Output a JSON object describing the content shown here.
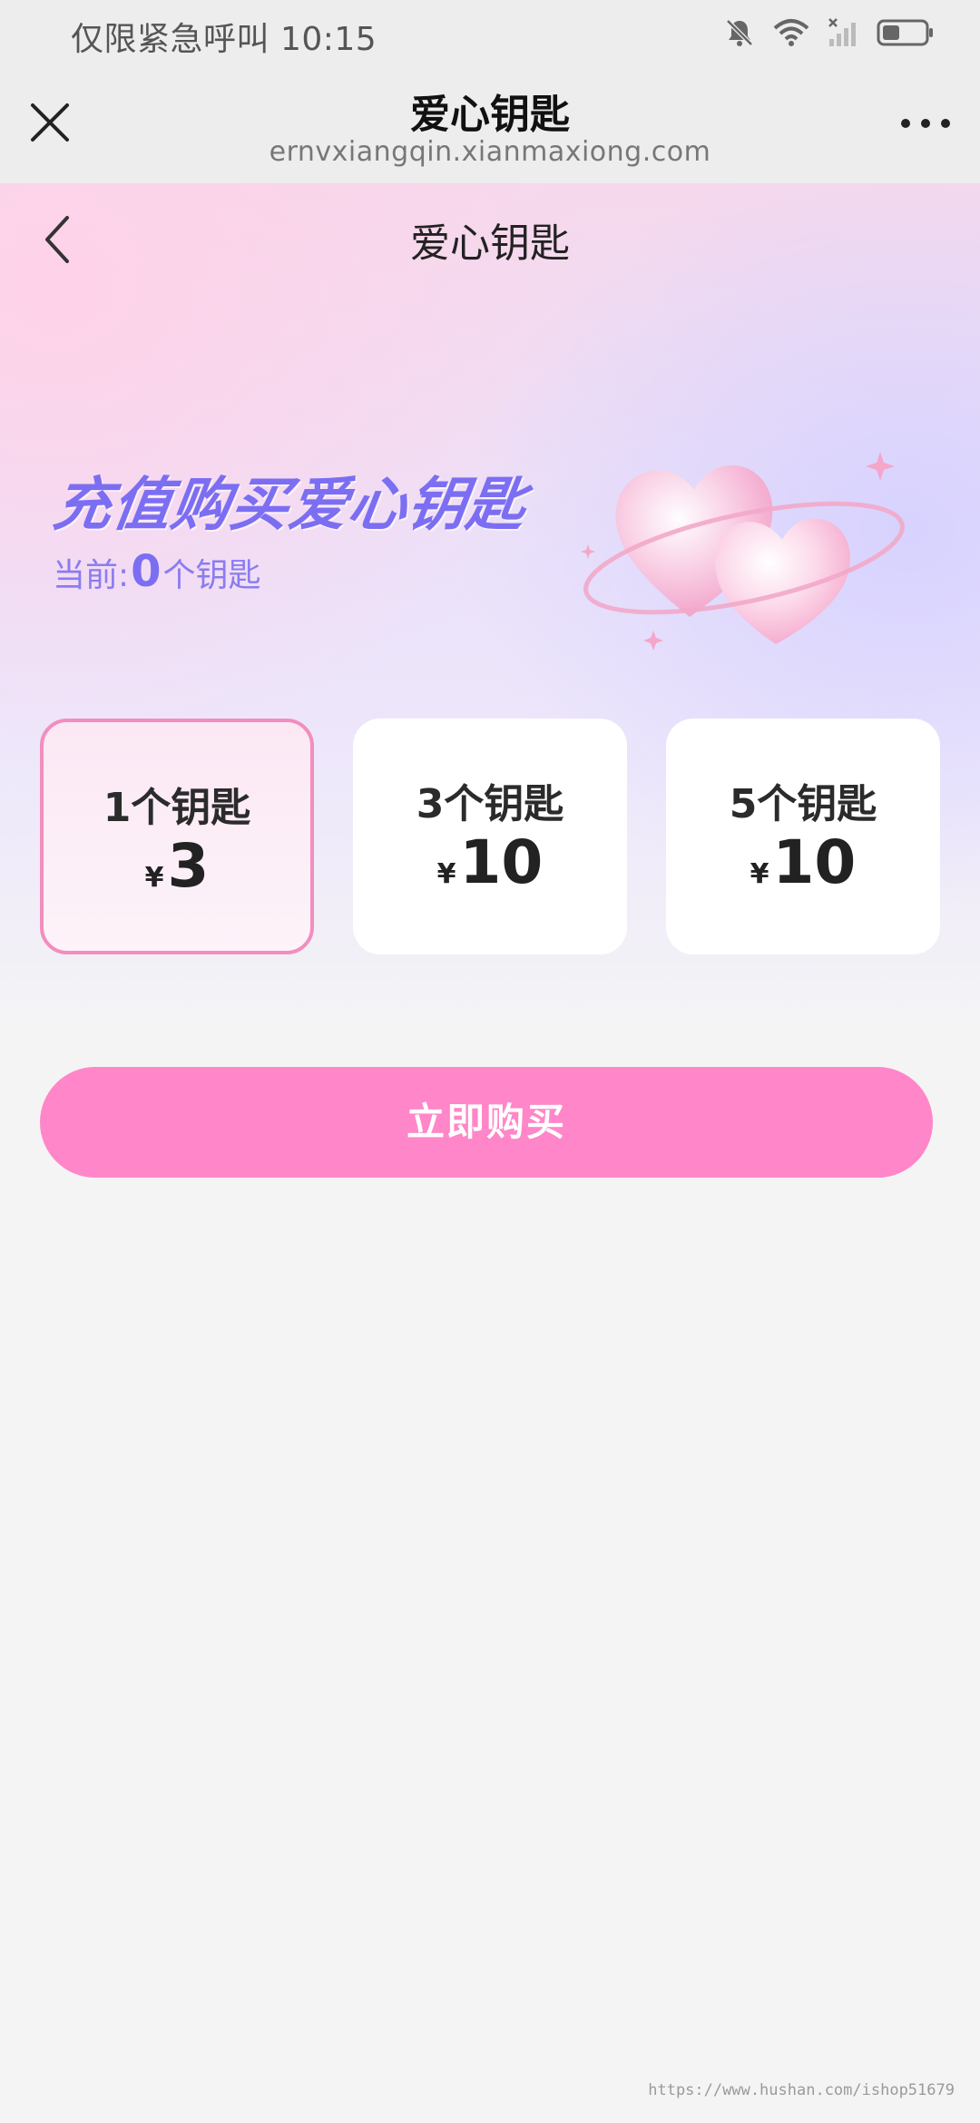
{
  "status_bar": {
    "text": "仅限紧急呼叫 10:15",
    "icons": [
      "bell-off-icon",
      "wifi-icon",
      "signal-icon",
      "battery-icon"
    ]
  },
  "browser": {
    "title": "爱心钥匙",
    "url": "ernvxiangqin.xianmaxiong.com",
    "close_icon": "close-icon",
    "more_icon": "more-icon"
  },
  "nav": {
    "title": "爱心钥匙",
    "back_icon": "back-icon"
  },
  "promo": {
    "title": "充值购买爱心钥匙",
    "balance_prefix": "当前:",
    "balance_value": "0",
    "balance_suffix": "个钥匙"
  },
  "packages": [
    {
      "label": "1个钥匙",
      "currency": "¥",
      "price": "3",
      "selected": true
    },
    {
      "label": "3个钥匙",
      "currency": "¥",
      "price": "10",
      "selected": false
    },
    {
      "label": "5个钥匙",
      "currency": "¥",
      "price": "10",
      "selected": false
    }
  ],
  "buy_button": {
    "label": "立即购买"
  },
  "watermark": "https://www.hushan.com/ishop51679",
  "colors": {
    "accent": "#ff86c8",
    "selected_border": "#f28ebd",
    "promo_text": "#7c6ef2"
  }
}
